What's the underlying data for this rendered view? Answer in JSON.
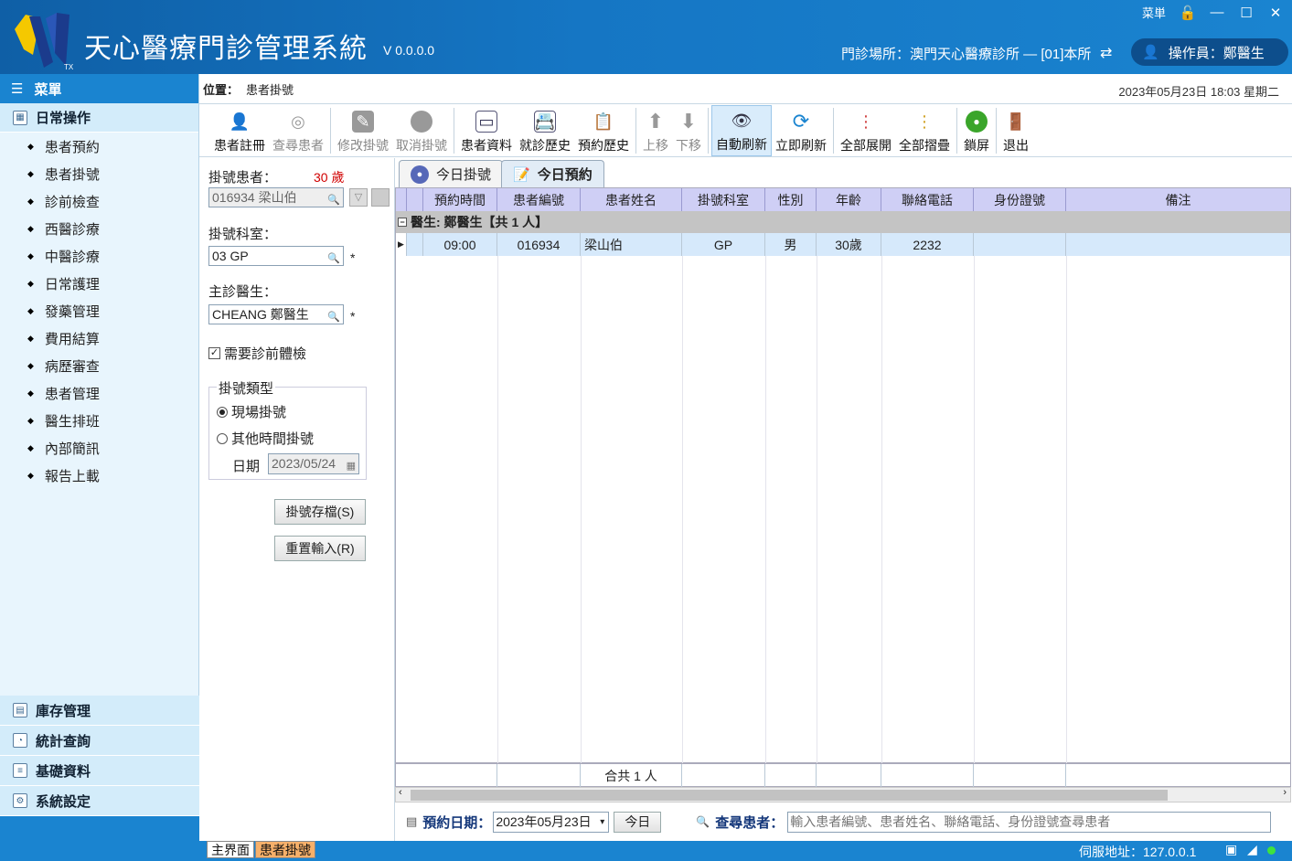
{
  "app": {
    "title": "天心醫療門診管理系統",
    "version": "V 0.0.0.0",
    "logo_mark": "TX"
  },
  "window_controls": {
    "menu_label": "菜単"
  },
  "header": {
    "clinic": "門診場所：澳門天心醫療診所 — [01]本所",
    "operator": "操作員：鄭醫生"
  },
  "sidebar": {
    "menu_title": "菜單",
    "group_title": "日常操作",
    "items": [
      {
        "label": "患者預約"
      },
      {
        "label": "患者掛號"
      },
      {
        "label": "診前檢查"
      },
      {
        "label": "西醫診療"
      },
      {
        "label": "中醫診療"
      },
      {
        "label": "日常護理"
      },
      {
        "label": "發藥管理"
      },
      {
        "label": "費用結算"
      },
      {
        "label": "病歷審查"
      },
      {
        "label": "患者管理"
      },
      {
        "label": "醫生排班"
      },
      {
        "label": "內部簡訊"
      },
      {
        "label": "報告上載"
      }
    ],
    "bottom_groups": [
      {
        "label": "庫存管理"
      },
      {
        "label": "統計查詢"
      },
      {
        "label": "基礎資料"
      },
      {
        "label": "系統設定"
      }
    ]
  },
  "location": {
    "label": "位置：",
    "value": "患者掛號",
    "datetime": "2023年05月23日 18:03  星期二"
  },
  "toolbar": {
    "register": "患者註冊",
    "search": "查尋患者",
    "modify": "修改掛號",
    "cancel": "取消掛號",
    "patient_info": "患者資料",
    "visit_history": "就診歷史",
    "appt_history": "預約歷史",
    "move_up": "上移",
    "move_down": "下移",
    "auto_refresh": "自動刷新",
    "refresh_now": "立即刷新",
    "expand_all": "全部展開",
    "collapse_all": "全部摺疊",
    "lock": "鎖屏",
    "exit": "退出"
  },
  "form": {
    "patient_label": "掛號患者：",
    "patient_age": "30 歲",
    "patient_value": "016934 梁山伯",
    "dept_label": "掛號科室：",
    "dept_value": "03 GP",
    "doctor_label": "主診醫生：",
    "doctor_value": "CHEANG 鄭醫生",
    "required_mark": "*",
    "precheck_label": "需要診前體檢",
    "precheck_checked": true,
    "type_legend": "掛號類型",
    "type_onsite": "現場掛號",
    "type_other": "其他時間掛號",
    "date_label": "日期",
    "date_value": "2023/05/24",
    "save_button": "掛號存檔(S)",
    "reset_button": "重置輸入(R)"
  },
  "tabs": {
    "today_registration": "今日掛號",
    "today_appointment": "今日預約",
    "active": "今日預約"
  },
  "grid": {
    "columns": [
      "預約時間",
      "患者編號",
      "患者姓名",
      "掛號科室",
      "性別",
      "年齡",
      "聯絡電話",
      "身份證號",
      "備注"
    ],
    "group_row": "醫生: 鄭醫生【共 1 人】",
    "rows": [
      {
        "time": "09:00",
        "id": "016934",
        "name": "梁山伯",
        "dept": "GP",
        "sex": "男",
        "age": "30歲",
        "phone": "2232",
        "idno": "",
        "note": ""
      }
    ],
    "summary": "合共 1 人"
  },
  "bottombar": {
    "date_label": "預約日期：",
    "date_value": "2023年05月23日",
    "today_button": "今日",
    "search_label": "查尋患者：",
    "search_placeholder": "輸入患者編號、患者姓名、聯絡電話、身份證號查尋患者"
  },
  "statusbar": {
    "tab_main": "主界面",
    "tab_reg": "患者掛號",
    "server": "伺服地址：127.0.0.1"
  },
  "colors": {
    "brand": "#1576c4",
    "grid_header": "#cfcff5",
    "selected_row": "#d6e9fb",
    "age_red": "#d00000"
  }
}
